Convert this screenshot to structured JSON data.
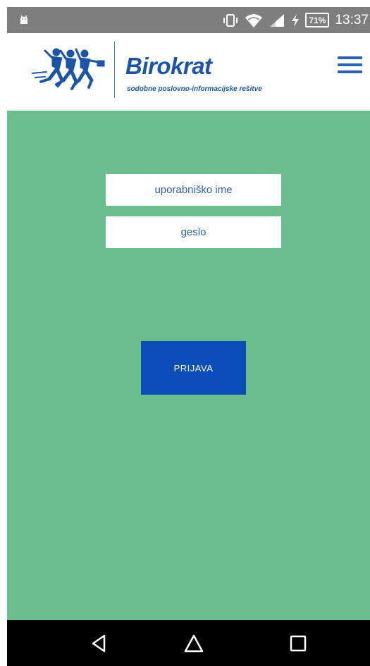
{
  "status_bar": {
    "notification_icon": "android-icon",
    "icons": [
      "vibrate-icon",
      "wifi-icon",
      "signal-icon",
      "charging-icon"
    ],
    "battery_level": "71%",
    "time": "13:37"
  },
  "header": {
    "brand_name": "Birokrat",
    "tagline": "sodobne poslovno-informacijske rešitve",
    "menu_icon": "hamburger-menu-icon"
  },
  "login": {
    "username_placeholder": "uporabniško ime",
    "username_value": "",
    "password_placeholder": "geslo",
    "password_value": "",
    "submit_label": "PRIJAVA"
  },
  "nav_bar": {
    "icons": [
      "back-icon",
      "home-icon",
      "recent-apps-icon"
    ]
  },
  "colors": {
    "header_bg": "#ffffff",
    "brand_blue": "#1c55a7",
    "main_bg": "#6bbd8b",
    "button_bg": "#0b4db6",
    "status_bar_bg": "#7e7e7e",
    "nav_bar_bg": "#000000"
  }
}
